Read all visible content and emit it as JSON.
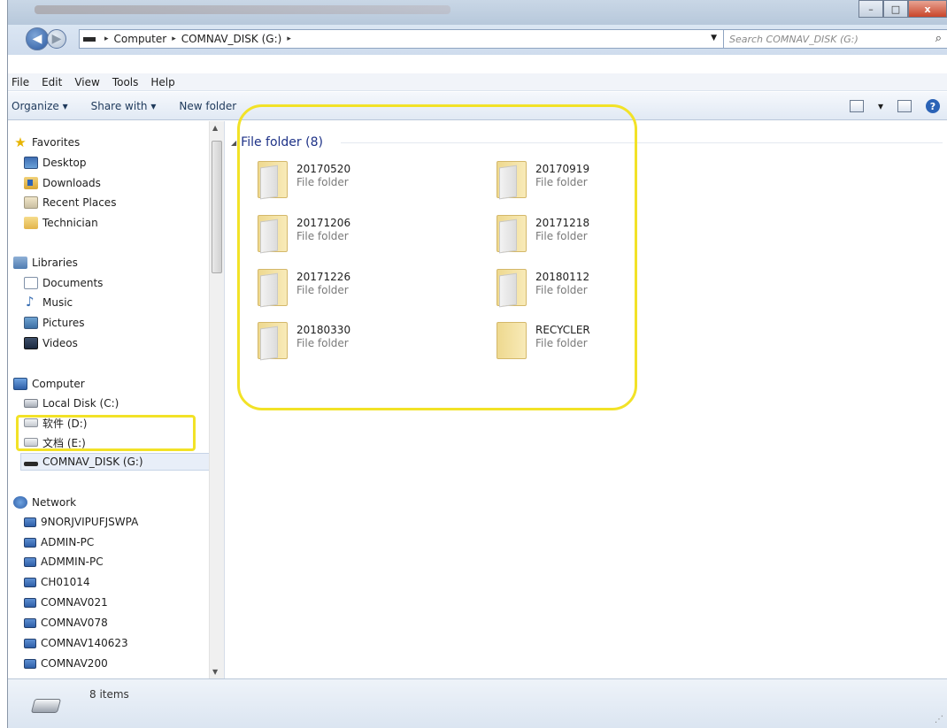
{
  "window": {
    "controls": {
      "minimize": "–",
      "maximize": "□",
      "close": "x"
    }
  },
  "address": {
    "back": "◀",
    "forward": "▶",
    "crumbs": [
      "Computer",
      "COMNAV_DISK (G:)"
    ],
    "sep": "▸",
    "refresh": "⁴⁄"
  },
  "search": {
    "placeholder": "Search COMNAV_DISK (G:)",
    "icon": "⌕"
  },
  "menu": [
    "File",
    "Edit",
    "View",
    "Tools",
    "Help"
  ],
  "toolbar": {
    "organize": "Organize ▾",
    "share_with": "Share with ▾",
    "new_folder": "New folder",
    "view_caret": "▾",
    "help": "?"
  },
  "nav": {
    "favorites": {
      "label": "Favorites",
      "items": [
        "Desktop",
        "Downloads",
        "Recent Places",
        "Technician"
      ]
    },
    "libraries": {
      "label": "Libraries",
      "items": [
        "Documents",
        "Music",
        "Pictures",
        "Videos"
      ]
    },
    "computer": {
      "label": "Computer",
      "items": [
        "Local Disk (C:)",
        "软件 (D:)",
        "文档 (E:)",
        "COMNAV_DISK (G:)"
      ],
      "selected": "COMNAV_DISK (G:)"
    },
    "network": {
      "label": "Network",
      "items": [
        "9NORJVIPUFJSWPA",
        "ADMIN-PC",
        "ADMMIN-PC",
        "CH01014",
        "COMNAV021",
        "COMNAV078",
        "COMNAV140623",
        "COMNAV200"
      ]
    }
  },
  "content": {
    "group_header": "File folder (8)",
    "folders": [
      {
        "name": "20170520",
        "type": "File folder"
      },
      {
        "name": "20170919",
        "type": "File folder"
      },
      {
        "name": "20171206",
        "type": "File folder"
      },
      {
        "name": "20171218",
        "type": "File folder"
      },
      {
        "name": "20171226",
        "type": "File folder"
      },
      {
        "name": "20180112",
        "type": "File folder"
      },
      {
        "name": "20180330",
        "type": "File folder"
      },
      {
        "name": "RECYCLER",
        "type": "File folder"
      }
    ]
  },
  "status": {
    "item_count": "8 items"
  },
  "colors": {
    "highlight": "#f2e227",
    "group_header": "#1e3287"
  }
}
